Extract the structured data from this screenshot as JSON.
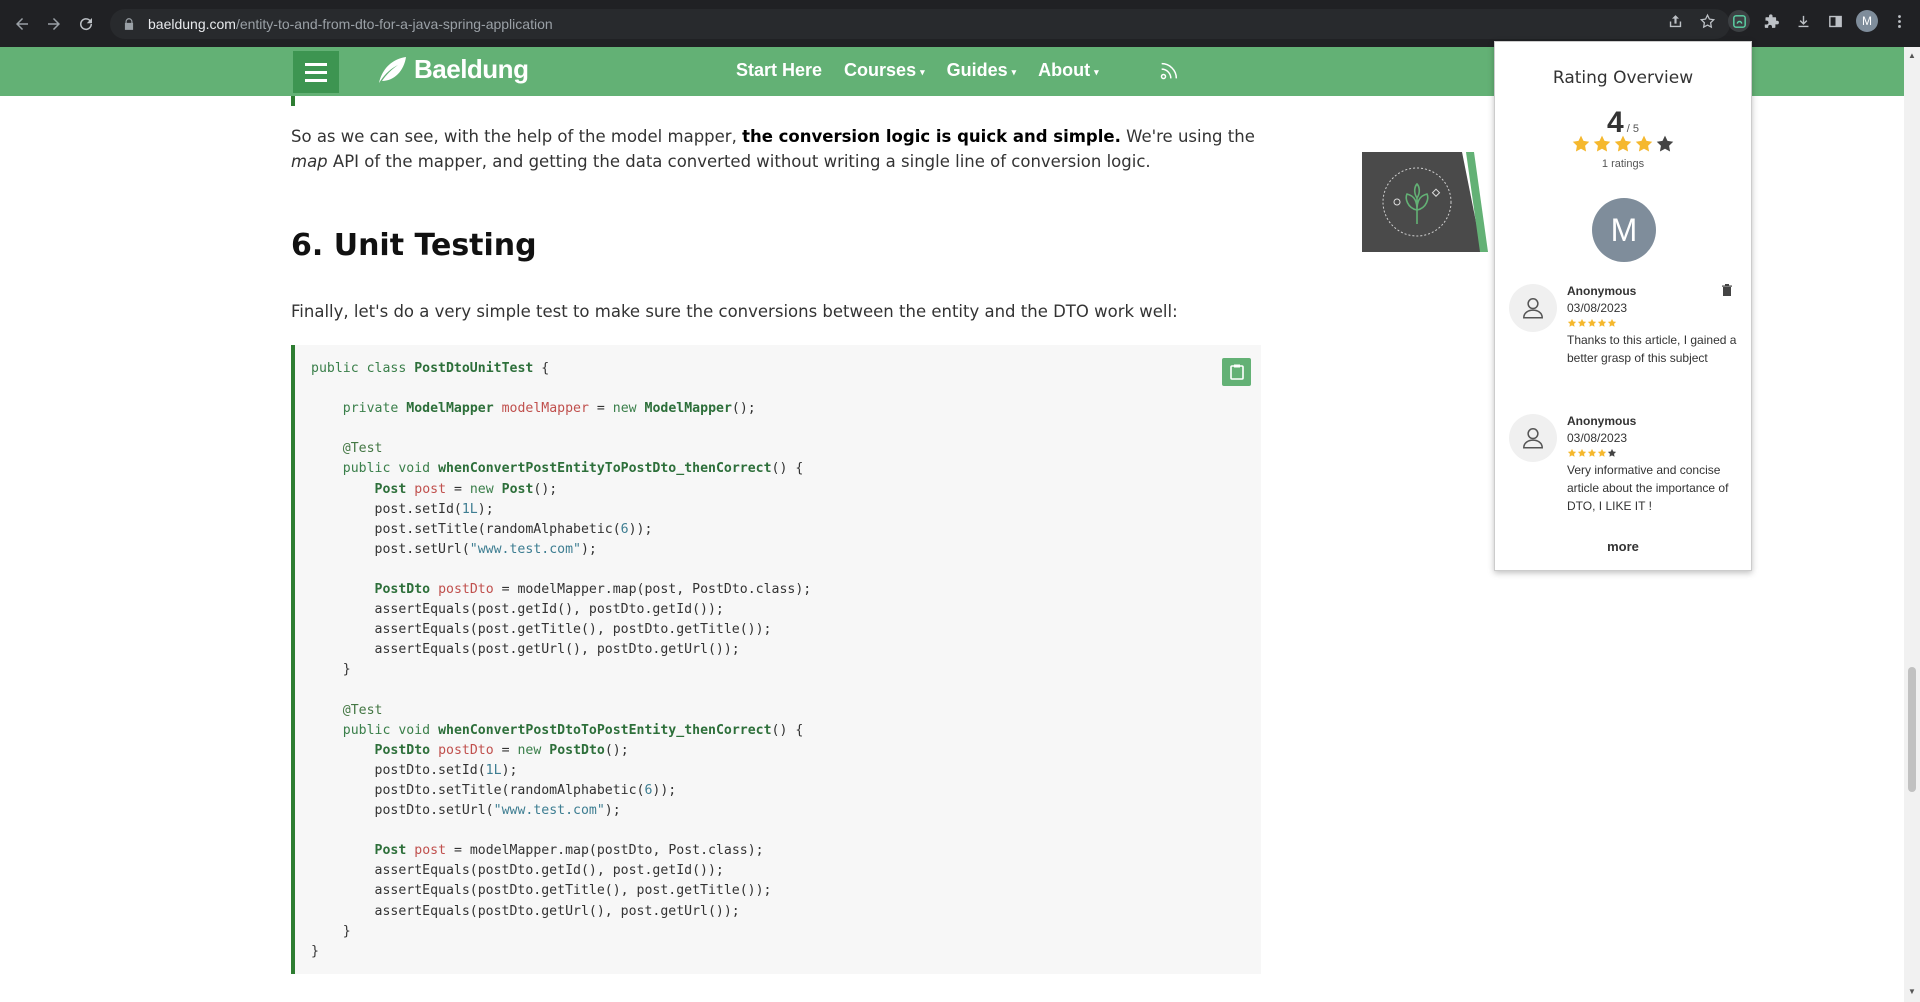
{
  "browser": {
    "url_host": "baeldung.com",
    "url_path": "/entity-to-and-from-dto-for-a-java-spring-application",
    "profile_initial": "M"
  },
  "site": {
    "brand": "Baeldung",
    "nav": [
      {
        "label": "Start Here",
        "caret": ""
      },
      {
        "label": "Courses",
        "caret": "▾"
      },
      {
        "label": "Guides",
        "caret": "▾"
      },
      {
        "label": "About",
        "caret": "▾"
      }
    ]
  },
  "article": {
    "para1_a": "So as we can see, with the help of the model mapper, ",
    "para1_bold": "the conversion logic is quick and simple.",
    "para1_b": " We're using the ",
    "para1_italic": "map",
    "para1_c": " API of the mapper, and getting the data converted without writing a single line of conversion logic.",
    "heading": "6. Unit Testing",
    "para2": "Finally, let's do a very simple test to make sure the conversions between the entity and the DTO work well:"
  },
  "rating": {
    "title": "Rating Overview",
    "score": "4",
    "out_of": " / 5",
    "stars": 4,
    "count_label": "1 ratings",
    "avatar_initial": "M",
    "more_label": "more",
    "reviews": [
      {
        "name": "Anonymous",
        "date": "03/08/2023",
        "stars": 5,
        "text": "Thanks to this article, I gained a better grasp of this subject"
      },
      {
        "name": "Anonymous",
        "date": "03/08/2023",
        "stars": 4,
        "text": "Very informative and concise article about the importance of DTO, I LIKE IT !"
      }
    ]
  },
  "colors": {
    "brand_green": "#63b175",
    "dark_green": "#2e7d32",
    "star": "#f5b82e"
  }
}
